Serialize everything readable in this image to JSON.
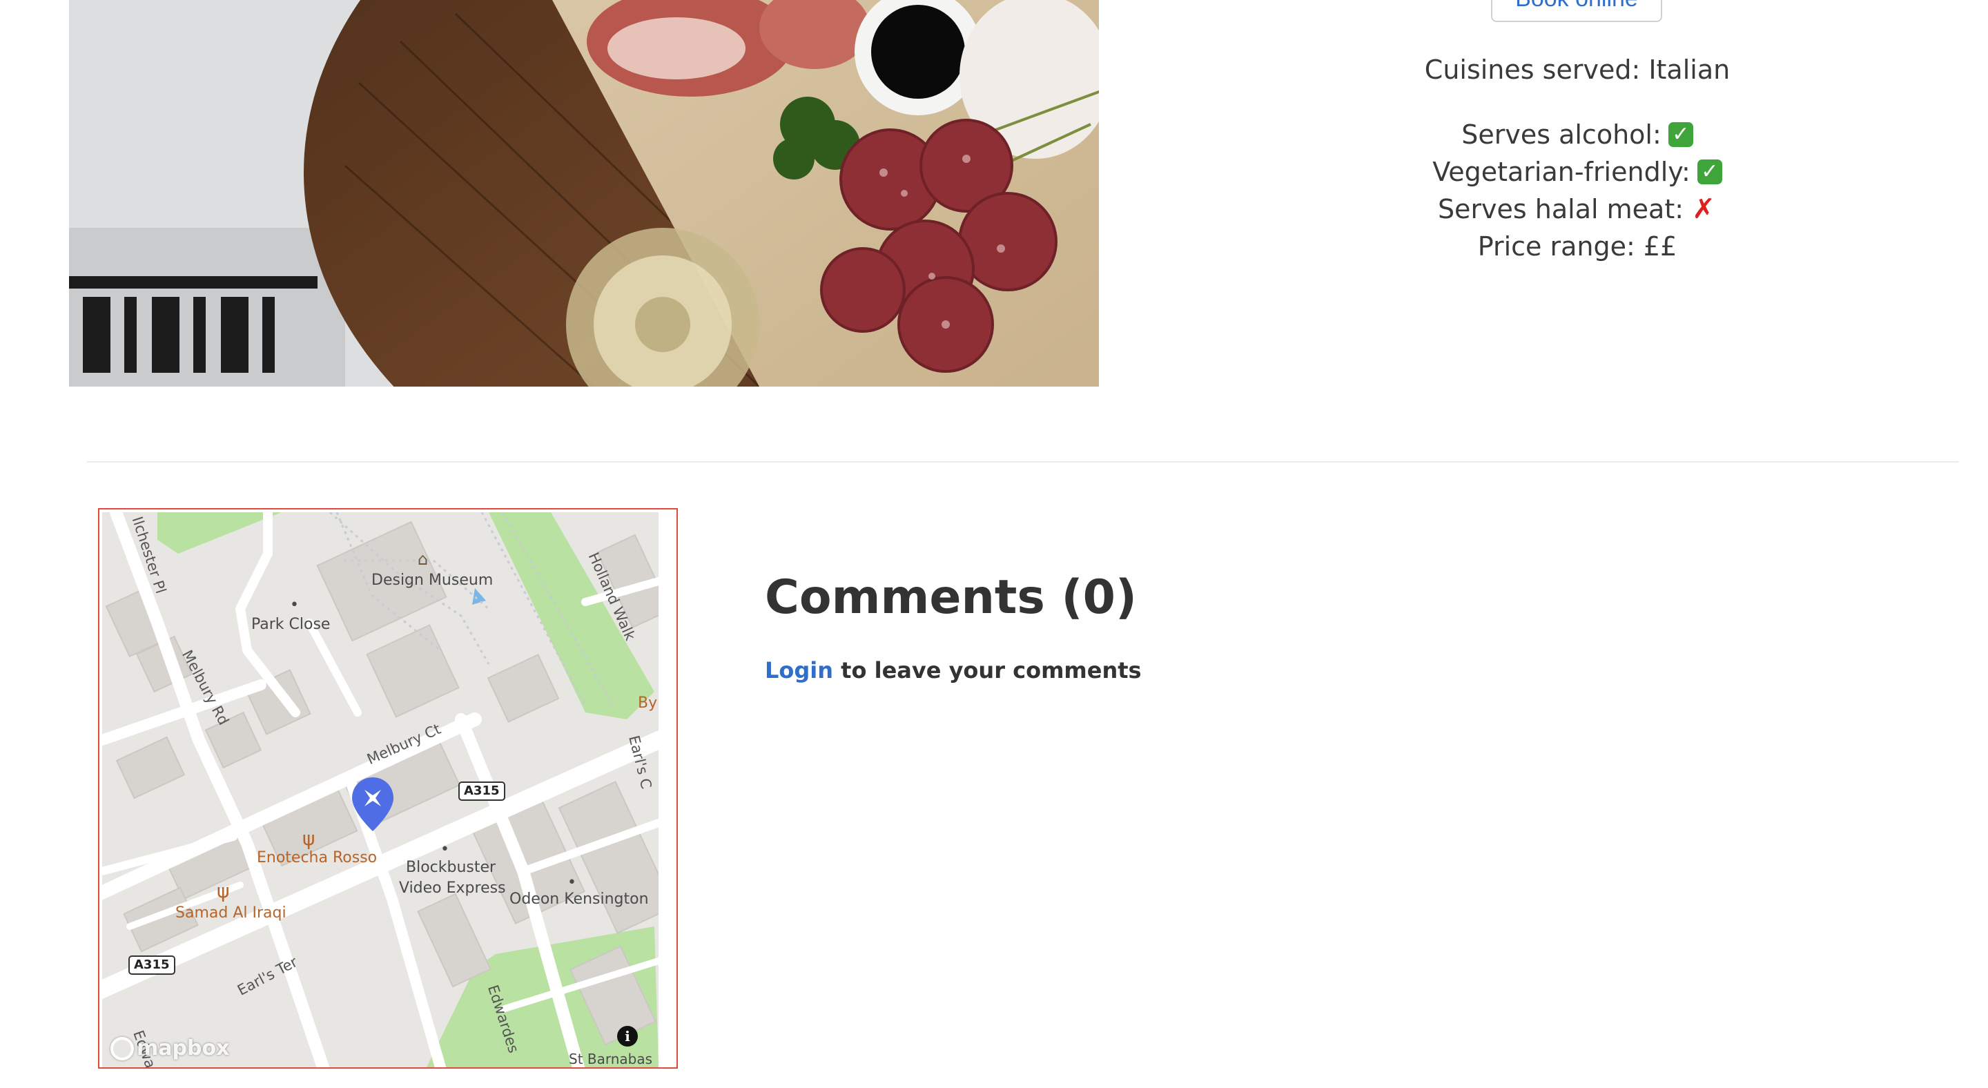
{
  "hero": {
    "alt": "Charcuterie board with cured meats, salami, parsley, balsamic dip and a glass of white wine"
  },
  "booking": {
    "button_label": "Book online"
  },
  "details": {
    "cuisines": "Cuisines served: Italian",
    "facts": [
      {
        "label": "Serves alcohol:",
        "value": "✓",
        "icon": "check-icon"
      },
      {
        "label": "Vegetarian-friendly:",
        "value": "✓",
        "icon": "check-icon"
      },
      {
        "label": "Serves halal meat:",
        "value": "✗",
        "icon": "cross-icon"
      }
    ],
    "price_range": "Price range: ££"
  },
  "map": {
    "labels": {
      "design_museum": "Design Museum",
      "park_close": "Park Close",
      "ilchester_pl": "Ilchester Pl",
      "melbury_rd": "Melbury Rd",
      "melbury_ct": "Melbury Ct",
      "holland_walk": "Holland Walk",
      "earls_ct": "Earl's C",
      "by": "By",
      "enotecha_rosso": "Enotecha Rosso",
      "samad_al_iraqi": "Samad Al Iraqi",
      "blockbuster_1": "Blockbuster",
      "blockbuster_2": "Video Express",
      "odeon": "Odeon Kensington",
      "earls_ter": "Earl's Ter",
      "edwardes": "Edwardes",
      "st_barnabas": "St Barnabas",
      "edwar": "Edwar"
    },
    "shields": {
      "a315_top": "A315",
      "a315_bottom": "A315"
    },
    "attribution": "mapbox",
    "info_icon": "i",
    "colors": {
      "marker": "#4f6ee6",
      "park": "#b9e1a2",
      "road": "#ffffff",
      "building": "#d7d4d0",
      "border": "#e04a3a"
    }
  },
  "comments": {
    "title": "Comments (0)",
    "login_link": "Login",
    "prompt_rest": " to leave your comments"
  }
}
